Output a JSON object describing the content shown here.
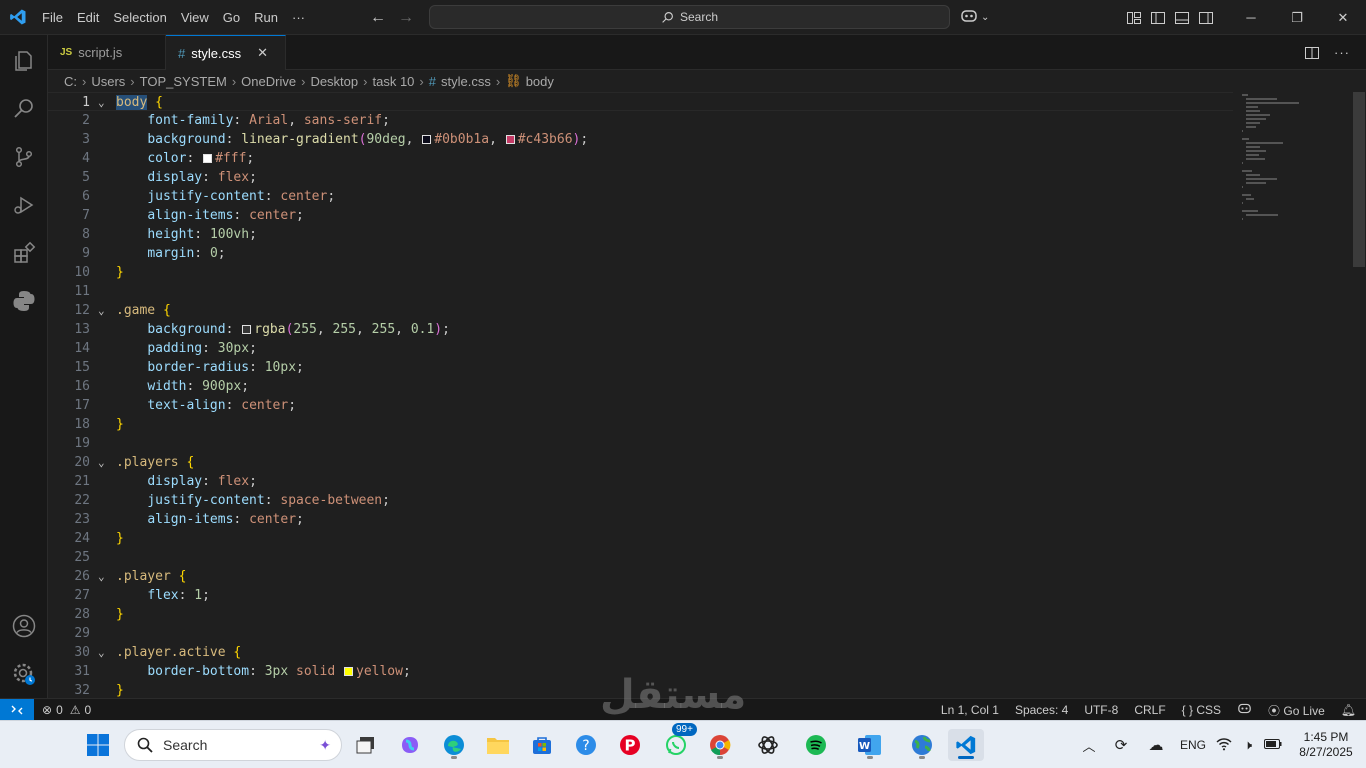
{
  "titlebar": {
    "menu": [
      "File",
      "Edit",
      "Selection",
      "View",
      "Go",
      "Run",
      "···"
    ],
    "search_label": "Search"
  },
  "tabs": [
    {
      "icon": "JS",
      "label": "script.js",
      "active": false
    },
    {
      "icon": "#",
      "label": "style.css",
      "active": true
    }
  ],
  "breadcrumb": [
    "C:",
    "Users",
    "TOP_SYSTEM",
    "OneDrive",
    "Desktop",
    "task 10",
    "style.css",
    "body"
  ],
  "editor": {
    "active_line": 1,
    "lines": [
      "body {",
      "    font-family: Arial, sans-serif;",
      "    background: linear-gradient(90deg, #0b0b1a, #c43b66);",
      "    color: #fff;",
      "    display: flex;",
      "    justify-content: center;",
      "    align-items: center;",
      "    height: 100vh;",
      "    margin: 0;",
      "}",
      "",
      ".game {",
      "    background: rgba(255, 255, 255, 0.1);",
      "    padding: 30px;",
      "    border-radius: 10px;",
      "    width: 900px;",
      "    text-align: center;",
      "}",
      "",
      ".players {",
      "    display: flex;",
      "    justify-content: space-between;",
      "    align-items: center;",
      "}",
      "",
      ".player {",
      "    flex: 1;",
      "}",
      "",
      ".player.active {",
      "    border-bottom: 3px solid yellow;",
      "}"
    ]
  },
  "statusbar": {
    "errors": "0",
    "warnings": "0",
    "position": "Ln 1, Col 1",
    "spaces": "Spaces: 4",
    "encoding": "UTF-8",
    "eol": "CRLF",
    "language": "CSS",
    "golive": "Go Live"
  },
  "taskbar": {
    "search_label": "Search",
    "badge": "99+",
    "lang": "ENG",
    "time": "1:45 PM",
    "date": "8/27/2025"
  },
  "watermark": "مستقل",
  "colors": {
    "accent": "#0078d4",
    "swatch_dark": "#0b0b1a",
    "swatch_pink": "#c43b66",
    "swatch_white": "#ffffff",
    "swatch_yellow": "#ffff00"
  }
}
